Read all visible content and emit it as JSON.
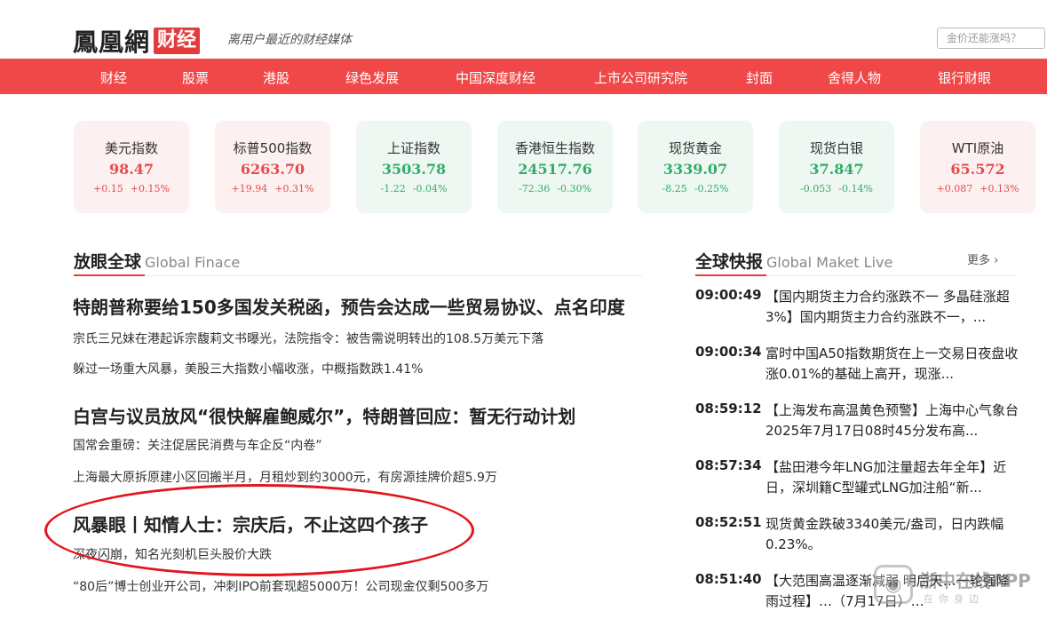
{
  "header": {
    "logo_text": "鳳凰網",
    "logo_badge": "财经",
    "slogan": "离用户最近的财经媒体",
    "search_placeholder": "金价还能涨吗？"
  },
  "nav": {
    "items": [
      "财经",
      "股票",
      "港股",
      "绿色发展",
      "中国深度财经",
      "上市公司研究院",
      "封面",
      "舍得人物",
      "银行财眼"
    ]
  },
  "markets": [
    {
      "name": "美元指数",
      "value": "98.47",
      "change": "+0.15",
      "pct": "+0.15%",
      "trend": "up"
    },
    {
      "name": "标普500指数",
      "value": "6263.70",
      "change": "+19.94",
      "pct": "+0.31%",
      "trend": "up"
    },
    {
      "name": "上证指数",
      "value": "3503.78",
      "change": "-1.22",
      "pct": "-0.04%",
      "trend": "down"
    },
    {
      "name": "香港恒生指数",
      "value": "24517.76",
      "change": "-72.36",
      "pct": "-0.30%",
      "trend": "down"
    },
    {
      "name": "现货黄金",
      "value": "3339.07",
      "change": "-8.25",
      "pct": "-0.25%",
      "trend": "down"
    },
    {
      "name": "现货白银",
      "value": "37.847",
      "change": "-0.053",
      "pct": "-0.14%",
      "trend": "down"
    },
    {
      "name": "WTI原油",
      "value": "65.572",
      "change": "+0.087",
      "pct": "+0.13%",
      "trend": "up"
    }
  ],
  "global_section": {
    "title_cn": "放眼全球",
    "title_en": "Global Finace"
  },
  "news": [
    {
      "headline": "特朗普称要给150多国发关税函，预告会达成一些贸易协议、点名印度",
      "subs": [
        "宗氏三兄妹在港起诉宗馥莉文书曝光，法院指令：被告需说明转出的108.5万美元下落",
        "躲过一场重大风暴，美股三大指数小幅收涨，中概指数跌1.41%"
      ]
    },
    {
      "headline": "白宫与议员放风“很快解雇鲍威尔”，特朗普回应：暂无行动计划",
      "subs": [
        "国常会重磅：关注促居民消费与车企反“内卷”",
        "上海最大原拆原建小区回搬半月，月租炒到约3000元，有房源挂牌价超5.9万"
      ]
    },
    {
      "headline": "风暴眼丨知情人士：宗庆后，不止这四个孩子",
      "subs": [
        "深夜闪崩，知名光刻机巨头股价大跌",
        "“80后”博士创业开公司，冲刺IPO前套现超5000万！公司现金仅剩500多万"
      ]
    }
  ],
  "live_section": {
    "title_cn": "全球快报",
    "title_en": "Global Maket Live",
    "more_label": "更多",
    "items": [
      {
        "time": "09:00:49",
        "text": "【国内期货主力合约涨跌不一 多晶硅涨超3%】国内期货主力合约涨跌不一，..."
      },
      {
        "time": "09:00:34",
        "text": "富时中国A50指数期货在上一交易日夜盘收涨0.01%的基础上高开，现涨..."
      },
      {
        "time": "08:59:12",
        "text": "【上海发布高温黄色预警】上海中心气象台2025年7月17日08时45分发布高..."
      },
      {
        "time": "08:57:34",
        "text": "【盐田港今年LNG加注量超去年全年】近日，深圳籍C型罐式LNG加注船“新..."
      },
      {
        "time": "08:52:51",
        "text": "现货黄金跌破3340美元/盎司，日内跌幅0.23%。"
      },
      {
        "time": "08:51:40",
        "text": "【大范围高温逐渐减弱 明后天…一轮强降雨过程】…（7月17日）…"
      }
    ]
  },
  "watermark": {
    "title": "浙中在线APP",
    "sub": "在你身边"
  },
  "colors": {
    "brand_red": "#f04848",
    "up": "#e84b4b",
    "down": "#2fae6a",
    "annotation": "#e3151c"
  }
}
